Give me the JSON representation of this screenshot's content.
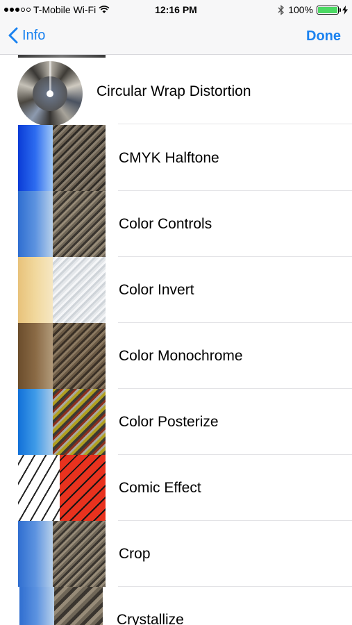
{
  "status_bar": {
    "carrier": "T-Mobile Wi-Fi",
    "time": "12:16 PM",
    "battery": "100%"
  },
  "nav": {
    "back_label": "Info",
    "done_label": "Done"
  },
  "filters": [
    "Circular Wrap Distortion",
    "CMYK Halftone",
    "Color Controls",
    "Color Invert",
    "Color Monochrome",
    "Color Posterize",
    "Comic Effect",
    "Crop",
    "Crystallize"
  ]
}
